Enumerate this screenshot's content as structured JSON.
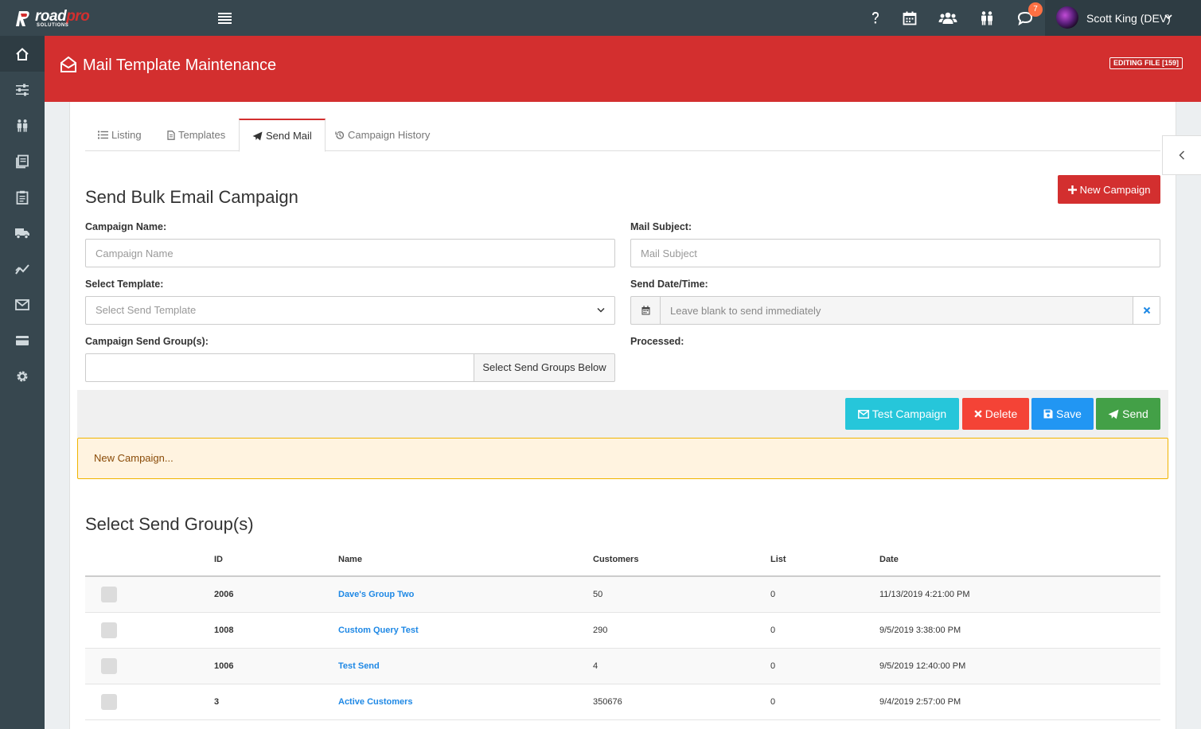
{
  "brand": {
    "logo_road": "road",
    "logo_pro": "pro",
    "logo_sub": "SOLUTIONS"
  },
  "topbar": {
    "icons": [
      "menu-icon",
      "help-icon",
      "calendar-icon",
      "users-icon",
      "people-icon",
      "chat-icon"
    ],
    "chat_badge": "7",
    "user": {
      "name": "Scott King (DEV)"
    }
  },
  "sidebar": {
    "items": [
      "home-icon",
      "sliders-icon",
      "people-icon",
      "documents-icon",
      "clipboard-icon",
      "truck-icon",
      "chart-icon",
      "mail-icon",
      "credit-card-icon",
      "gear-icon"
    ],
    "active_index": 0
  },
  "header": {
    "title": "Mail Template Maintenance",
    "badge": "EDITING FILE [159]"
  },
  "tabs": [
    {
      "label": "Listing",
      "icon": "list-icon"
    },
    {
      "label": "Templates",
      "icon": "file-icon"
    },
    {
      "label": "Send Mail",
      "icon": "paper-plane-icon",
      "active": true
    },
    {
      "label": "Campaign History",
      "icon": "history-icon"
    }
  ],
  "form": {
    "section_title": "Send Bulk Email Campaign",
    "new_campaign_label": "New Campaign",
    "campaign_name": {
      "label": "Campaign Name:",
      "placeholder": "Campaign Name",
      "value": ""
    },
    "mail_subject": {
      "label": "Mail Subject:",
      "placeholder": "Mail Subject",
      "value": ""
    },
    "template": {
      "label": "Select Template:",
      "placeholder": "Select Send Template"
    },
    "send_datetime": {
      "label": "Send Date/Time:",
      "placeholder": "Leave blank to send immediately"
    },
    "send_groups": {
      "label": "Campaign Send Group(s):",
      "button_label": "Select Send Groups Below"
    },
    "processed": {
      "label": "Processed:"
    }
  },
  "actions": {
    "test": "Test Campaign",
    "delete": "Delete",
    "save": "Save",
    "send": "Send"
  },
  "alert": {
    "message": "New Campaign..."
  },
  "groups": {
    "title": "Select Send Group(s)",
    "columns": [
      "ID",
      "Name",
      "Customers",
      "List",
      "Date"
    ],
    "rows": [
      {
        "id": "2006",
        "name": "Dave's Group Two",
        "customers": "50",
        "list": "0",
        "date": "11/13/2019 4:21:00 PM"
      },
      {
        "id": "1008",
        "name": "Custom Query Test",
        "customers": "290",
        "list": "0",
        "date": "9/5/2019 3:38:00 PM"
      },
      {
        "id": "1006",
        "name": "Test Send",
        "customers": "4",
        "list": "0",
        "date": "9/5/2019 12:40:00 PM"
      },
      {
        "id": "3",
        "name": "Active Customers",
        "customers": "350676",
        "list": "0",
        "date": "9/4/2019 2:57:00 PM"
      }
    ]
  },
  "colors": {
    "brand_red": "#d32f2f",
    "dark": "#37474f",
    "test": "#26c6da",
    "delete": "#f44336",
    "save": "#2196f3",
    "send": "#43a047",
    "link": "#1e88e5"
  }
}
